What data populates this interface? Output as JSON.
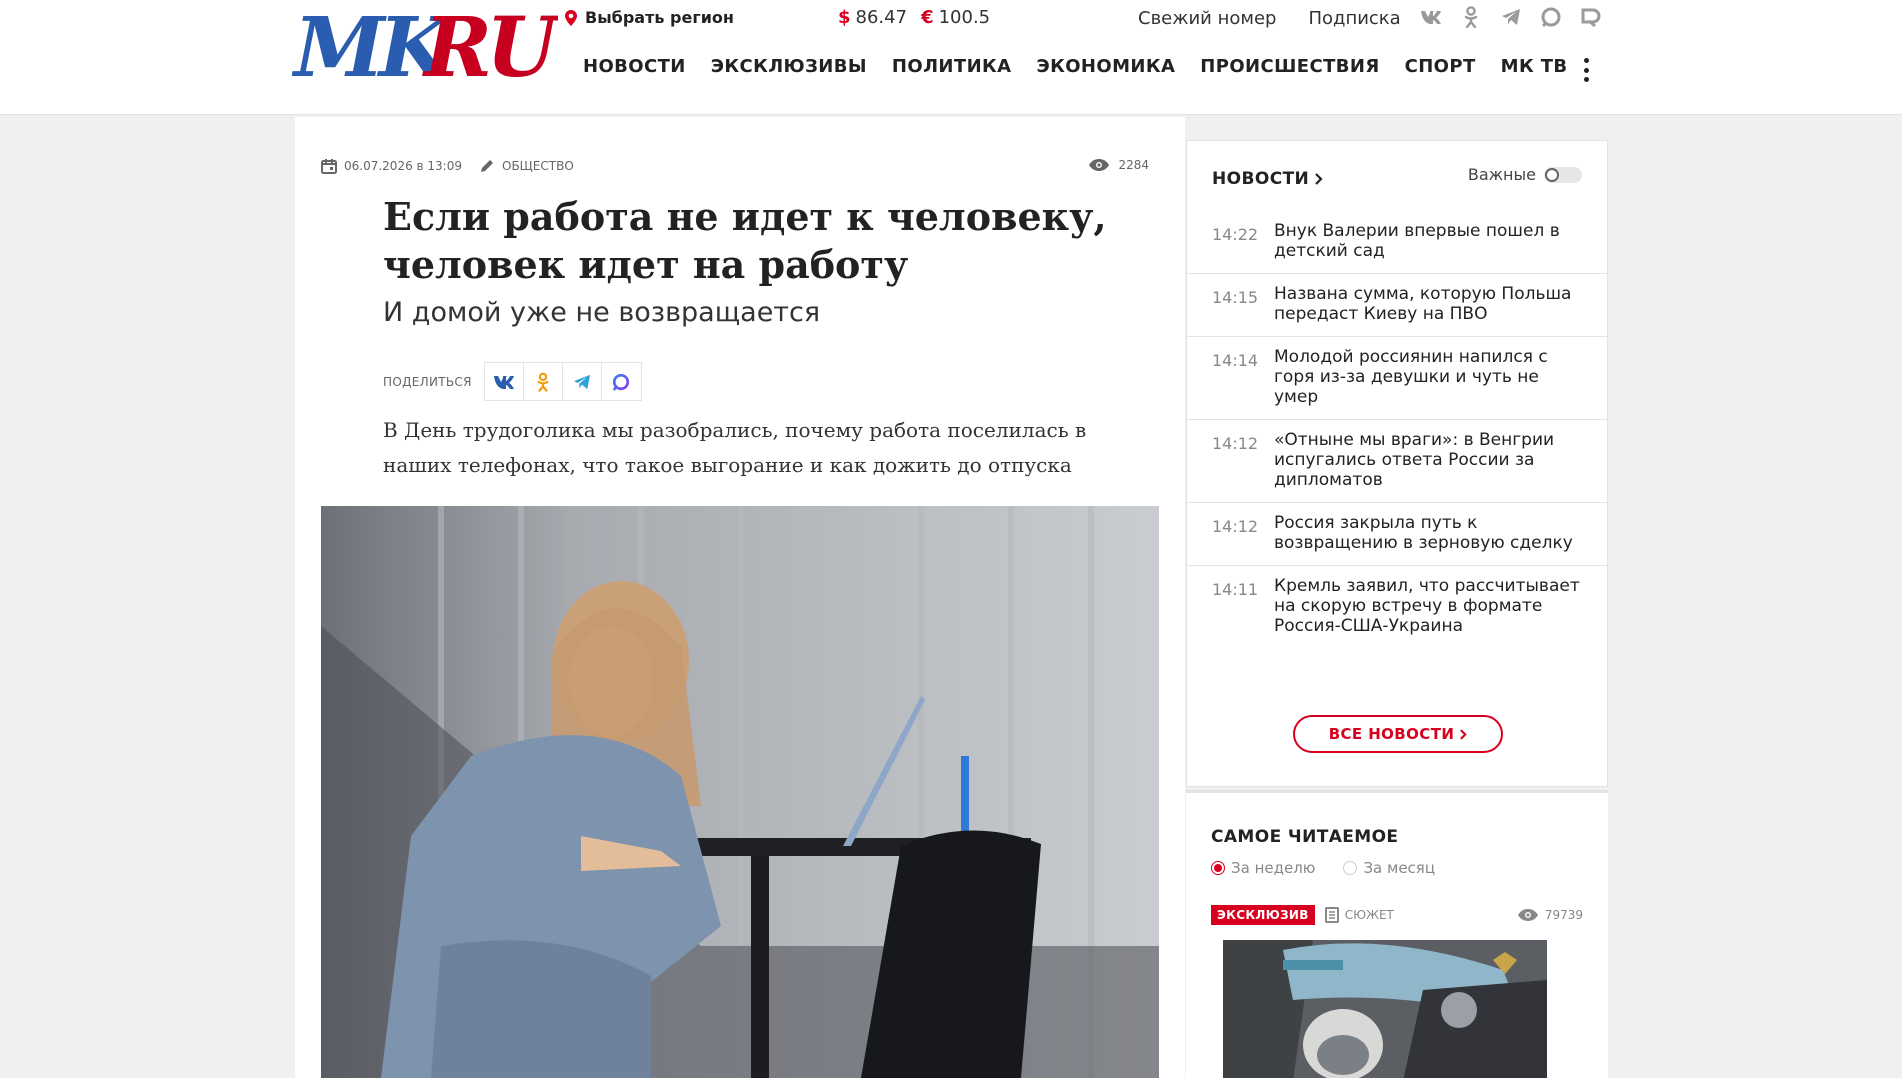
{
  "colors": {
    "accent": "#d8001f",
    "logo_blue": "#2a5db0",
    "logo_red": "#c8001f"
  },
  "header": {
    "logo_text": {
      "mk": "MK",
      "ru": "RU"
    },
    "region_label": "Выбрать регион",
    "rates": {
      "usd_symbol": "$",
      "usd": "86.47",
      "eur_symbol": "€",
      "eur": "100.5"
    },
    "toplinks": [
      "Свежий номер",
      "Подписка"
    ],
    "socials": [
      "vk-icon",
      "ok-icon",
      "telegram-icon",
      "max-icon",
      "rss-icon"
    ],
    "nav": [
      "НОВОСТИ",
      "ЭКСКЛЮЗИВЫ",
      "ПОЛИТИКА",
      "ЭКОНОМИКА",
      "ПРОИСШЕСТВИЯ",
      "СПОРТ",
      "МК ТВ"
    ]
  },
  "article": {
    "date": "06.07.2026 в 13:09",
    "rubric": "Общество",
    "views": "2284",
    "title": "Если работа не идет к человеку, человек идет на работу",
    "subtitle": "И домой уже не возвращается",
    "share_label": "Поделиться",
    "lead": "В День трудоголика мы разобрались, почему работа поселилась в наших телефонах, что такое выгорание и как дожить до отпуска",
    "photo_icon": "woman-at-laptop-photo"
  },
  "sidebar": {
    "news_title": "НОВОСТИ",
    "important_label": "Важные",
    "important_on": false,
    "news": [
      {
        "time": "14:22",
        "headline": "Внук Валерии впервые пошел в детский сад"
      },
      {
        "time": "14:15",
        "headline": "Названа сумма, которую Польша передаст Киеву на ПВО"
      },
      {
        "time": "14:14",
        "headline": "Молодой россиянин напился с горя из-за девушки и чуть не умер"
      },
      {
        "time": "14:12",
        "headline": "«Отныне мы враги»: в Венгрии испугались ответа России за дипломатов"
      },
      {
        "time": "14:12",
        "headline": "Россия закрыла путь к возвращению в зерновую сделку"
      },
      {
        "time": "14:11",
        "headline": "Кремль заявил, что рассчитывает на скорую встречу в формате Россия-США-Украина"
      }
    ],
    "all_news_label": "ВСЕ НОВОСТИ",
    "popular": {
      "title": "САМОЕ ЧИТАЕМОЕ",
      "filters": [
        "За неделю",
        "За месяц"
      ],
      "selected": "За неделю",
      "badge": "ЭКСКЛЮЗИВ",
      "story": "Сюжет",
      "views": "79739",
      "image_icon": "pilot-in-cockpit-photo"
    }
  }
}
